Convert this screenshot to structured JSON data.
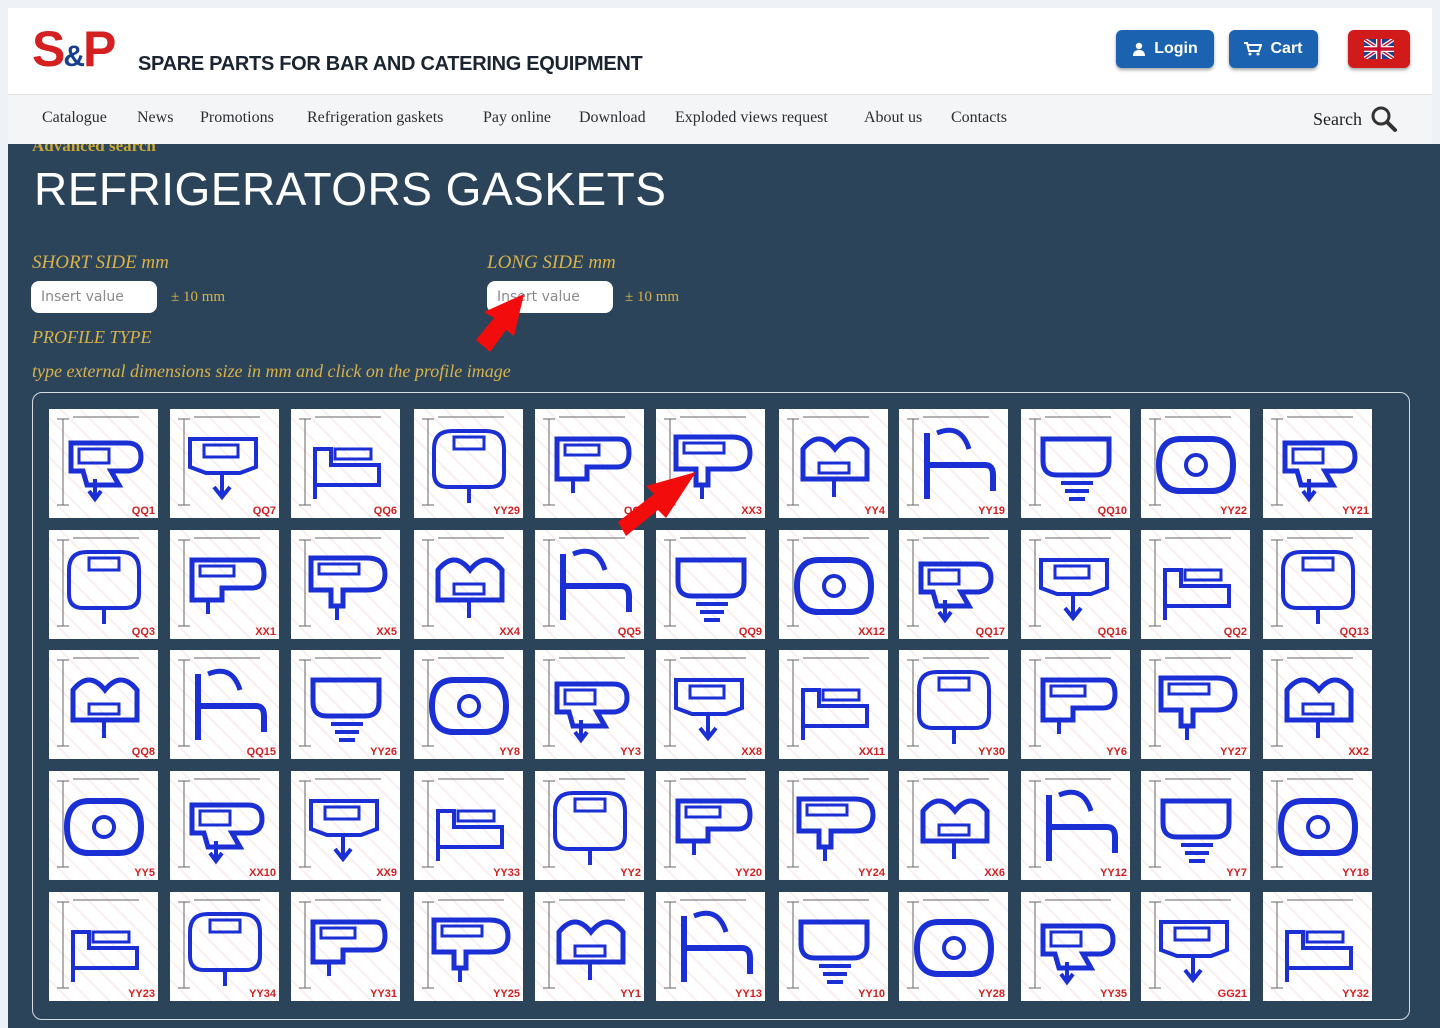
{
  "header": {
    "logo": {
      "s": "S",
      "amp": "&",
      "p": "P"
    },
    "tagline": "SPARE PARTS FOR BAR AND CATERING EQUIPMENT",
    "login_label": "Login",
    "cart_label": "Cart",
    "language": "uk-flag-icon"
  },
  "nav": {
    "items": [
      "Catalogue",
      "News",
      "Promotions",
      "Refrigeration gaskets",
      "Pay online",
      "Download",
      "Exploded views request",
      "About us",
      "Contacts"
    ],
    "search_label": "Search"
  },
  "main": {
    "advanced_search": "Advanced search",
    "title": "REFRIGERATORS GASKETS",
    "short_side_label": "SHORT SIDE mm",
    "long_side_label": "LONG SIDE mm",
    "short_placeholder": "Insert value",
    "long_placeholder": "Insert value",
    "tolerance": "± 10 mm",
    "profile_type_label": "PROFILE TYPE",
    "hint": "type external dimensions size in mm and click on the profile image",
    "profiles": [
      [
        "QQ1",
        "QQ7",
        "QQ6",
        "YY29",
        "QQ",
        "XX3",
        "YY4",
        "YY19",
        "QQ10",
        "YY22",
        "YY21"
      ],
      [
        "QQ3",
        "XX1",
        "XX5",
        "XX4",
        "QQ5",
        "QQ9",
        "XX12",
        "QQ17",
        "QQ16",
        "QQ2",
        "QQ13"
      ],
      [
        "QQ8",
        "QQ15",
        "YY26",
        "YY8",
        "YY3",
        "XX8",
        "XX11",
        "YY30",
        "YY6",
        "YY27",
        "XX2"
      ],
      [
        "YY5",
        "XX10",
        "XX9",
        "YY33",
        "YY2",
        "YY20",
        "YY24",
        "XX6",
        "YY12",
        "YY7",
        "YY18"
      ],
      [
        "YY23",
        "YY34",
        "YY31",
        "YY25",
        "YY1",
        "YY13",
        "YY10",
        "YY28",
        "YY35",
        "GG21",
        "YY32"
      ]
    ]
  },
  "colors": {
    "accent_blue": "#1b63b0",
    "panel_bg": "#2c4459",
    "label_gold": "#d8b24a",
    "logo_red": "#d42020",
    "gasket_blue": "#1a2fd4"
  }
}
